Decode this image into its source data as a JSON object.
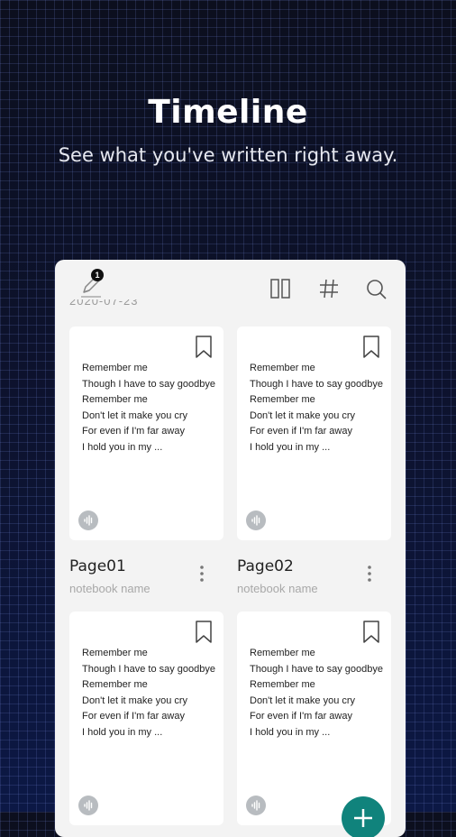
{
  "hero": {
    "title": "Timeline",
    "subtitle": "See what you've written right away."
  },
  "toolbar": {
    "pen_badge": "1",
    "icons": [
      "pen-icon",
      "layout-columns-icon",
      "hashtag-icon",
      "search-icon"
    ]
  },
  "date_header": "2020-07-23",
  "cards": [
    {
      "lines": [
        "Remember me",
        "Though I have to say goodbye",
        "Remember me",
        "Don't let it make you cry",
        "For even if I'm far away",
        "I hold you in my ..."
      ],
      "title": "Page01",
      "notebook": "notebook name"
    },
    {
      "lines": [
        "Remember me",
        "Though I have to say goodbye",
        "Remember me",
        "Don't let it make you cry",
        "For even if I'm far away",
        "I hold you in my ..."
      ],
      "title": "Page02",
      "notebook": "notebook name"
    },
    {
      "lines": [
        "Remember me",
        "Though I have to say goodbye",
        "Remember me",
        "Don't let it make you cry",
        "For even if I'm far away",
        "I hold you in my ..."
      ]
    },
    {
      "lines": [
        "Remember me",
        "Though I have to say goodbye",
        "Remember me",
        "Don't let it make you cry",
        "For even if I'm far away",
        "I hold you in my ..."
      ]
    }
  ],
  "colors": {
    "background": "#0c1026",
    "card": "#ffffff",
    "panel": "#f3f3f3",
    "accent": "#10837c",
    "muted_text": "#a8a8a8"
  }
}
